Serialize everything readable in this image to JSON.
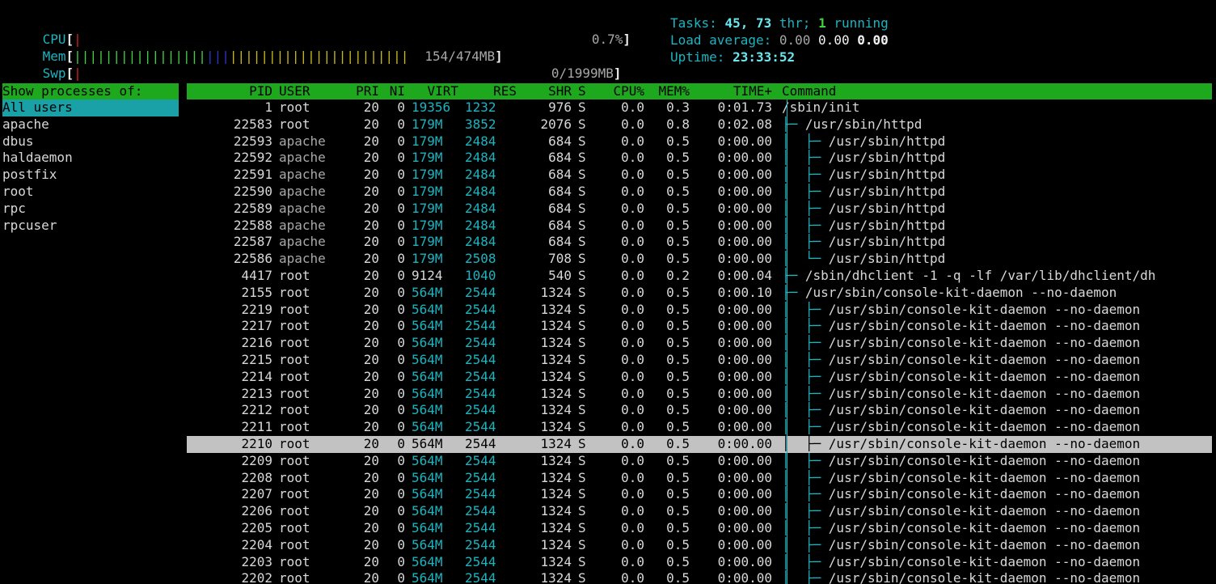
{
  "meters": {
    "cpu": {
      "label": "CPU",
      "percent": "0.7%",
      "usage_fraction": 0.007
    },
    "mem": {
      "label": "Mem",
      "value": "154/474MB",
      "used_mb": 154,
      "total_mb": 474,
      "bar_green": "|||||||||||||||||",
      "bar_blue": "|||",
      "bar_yellow": "|||||||||||||||||||||||"
    },
    "swp": {
      "label": "Swp",
      "value": "0/1999MB",
      "used_mb": 0,
      "total_mb": 1999
    }
  },
  "summary": {
    "tasks_label": "Tasks:",
    "tasks": "45,",
    "threads": "73",
    "threads_label": "thr;",
    "running": "1",
    "running_label": "running",
    "load_label": "Load average:",
    "load1": "0.00",
    "load5": "0.00",
    "load15": "0.00",
    "uptime_label": "Uptime:",
    "uptime": "23:33:52"
  },
  "sidebar": {
    "title": "Show processes of:",
    "items": [
      "All users",
      "apache",
      "dbus",
      "haldaemon",
      "postfix",
      "root",
      "rpc",
      "rpcuser"
    ]
  },
  "columns": {
    "pid": "PID",
    "user": "USER",
    "pri": "PRI",
    "ni": "NI",
    "virt": "VIRT",
    "res": "RES",
    "shr": "SHR",
    "s": "S",
    "cpu": "CPU%",
    "mem": "MEM%",
    "time": "TIME+",
    "command": "Command"
  },
  "processes": [
    {
      "pid": "1",
      "user": "root",
      "pri": "20",
      "ni": "0",
      "virt": "19356",
      "res": "1232",
      "shr": "976",
      "s": "S",
      "cpu": "0.0",
      "mem": "0.3",
      "time": "0:01.73",
      "tree": "",
      "command": "/sbin/init"
    },
    {
      "pid": "22583",
      "user": "root",
      "pri": "20",
      "ni": "0",
      "virt": "179M",
      "res": "3852",
      "shr": "2076",
      "s": "S",
      "cpu": "0.0",
      "mem": "0.8",
      "time": "0:02.08",
      "tree": "├─ ",
      "command": "/usr/sbin/httpd"
    },
    {
      "pid": "22593",
      "user": "apache",
      "pri": "20",
      "ni": "0",
      "virt": "179M",
      "res": "2484",
      "shr": "684",
      "s": "S",
      "cpu": "0.0",
      "mem": "0.5",
      "time": "0:00.00",
      "tree": "│  ├─ ",
      "command": "/usr/sbin/httpd"
    },
    {
      "pid": "22592",
      "user": "apache",
      "pri": "20",
      "ni": "0",
      "virt": "179M",
      "res": "2484",
      "shr": "684",
      "s": "S",
      "cpu": "0.0",
      "mem": "0.5",
      "time": "0:00.00",
      "tree": "│  ├─ ",
      "command": "/usr/sbin/httpd"
    },
    {
      "pid": "22591",
      "user": "apache",
      "pri": "20",
      "ni": "0",
      "virt": "179M",
      "res": "2484",
      "shr": "684",
      "s": "S",
      "cpu": "0.0",
      "mem": "0.5",
      "time": "0:00.00",
      "tree": "│  ├─ ",
      "command": "/usr/sbin/httpd"
    },
    {
      "pid": "22590",
      "user": "apache",
      "pri": "20",
      "ni": "0",
      "virt": "179M",
      "res": "2484",
      "shr": "684",
      "s": "S",
      "cpu": "0.0",
      "mem": "0.5",
      "time": "0:00.00",
      "tree": "│  ├─ ",
      "command": "/usr/sbin/httpd"
    },
    {
      "pid": "22589",
      "user": "apache",
      "pri": "20",
      "ni": "0",
      "virt": "179M",
      "res": "2484",
      "shr": "684",
      "s": "S",
      "cpu": "0.0",
      "mem": "0.5",
      "time": "0:00.00",
      "tree": "│  ├─ ",
      "command": "/usr/sbin/httpd"
    },
    {
      "pid": "22588",
      "user": "apache",
      "pri": "20",
      "ni": "0",
      "virt": "179M",
      "res": "2484",
      "shr": "684",
      "s": "S",
      "cpu": "0.0",
      "mem": "0.5",
      "time": "0:00.00",
      "tree": "│  ├─ ",
      "command": "/usr/sbin/httpd"
    },
    {
      "pid": "22587",
      "user": "apache",
      "pri": "20",
      "ni": "0",
      "virt": "179M",
      "res": "2484",
      "shr": "684",
      "s": "S",
      "cpu": "0.0",
      "mem": "0.5",
      "time": "0:00.00",
      "tree": "│  ├─ ",
      "command": "/usr/sbin/httpd"
    },
    {
      "pid": "22586",
      "user": "apache",
      "pri": "20",
      "ni": "0",
      "virt": "179M",
      "res": "2508",
      "shr": "708",
      "s": "S",
      "cpu": "0.0",
      "mem": "0.5",
      "time": "0:00.00",
      "tree": "│  └─ ",
      "command": "/usr/sbin/httpd"
    },
    {
      "pid": "4417",
      "user": "root",
      "pri": "20",
      "ni": "0",
      "virt": "9124",
      "res": "1040",
      "shr": "540",
      "s": "S",
      "cpu": "0.0",
      "mem": "0.2",
      "time": "0:00.04",
      "tree": "├─ ",
      "command": "/sbin/dhclient -1 -q -lf /var/lib/dhclient/dh"
    },
    {
      "pid": "2155",
      "user": "root",
      "pri": "20",
      "ni": "0",
      "virt": "564M",
      "res": "2544",
      "shr": "1324",
      "s": "S",
      "cpu": "0.0",
      "mem": "0.5",
      "time": "0:00.10",
      "tree": "├─ ",
      "command": "/usr/sbin/console-kit-daemon --no-daemon"
    },
    {
      "pid": "2219",
      "user": "root",
      "pri": "20",
      "ni": "0",
      "virt": "564M",
      "res": "2544",
      "shr": "1324",
      "s": "S",
      "cpu": "0.0",
      "mem": "0.5",
      "time": "0:00.00",
      "tree": "│  ├─ ",
      "command": "/usr/sbin/console-kit-daemon --no-daemon"
    },
    {
      "pid": "2217",
      "user": "root",
      "pri": "20",
      "ni": "0",
      "virt": "564M",
      "res": "2544",
      "shr": "1324",
      "s": "S",
      "cpu": "0.0",
      "mem": "0.5",
      "time": "0:00.00",
      "tree": "│  ├─ ",
      "command": "/usr/sbin/console-kit-daemon --no-daemon"
    },
    {
      "pid": "2216",
      "user": "root",
      "pri": "20",
      "ni": "0",
      "virt": "564M",
      "res": "2544",
      "shr": "1324",
      "s": "S",
      "cpu": "0.0",
      "mem": "0.5",
      "time": "0:00.00",
      "tree": "│  ├─ ",
      "command": "/usr/sbin/console-kit-daemon --no-daemon"
    },
    {
      "pid": "2215",
      "user": "root",
      "pri": "20",
      "ni": "0",
      "virt": "564M",
      "res": "2544",
      "shr": "1324",
      "s": "S",
      "cpu": "0.0",
      "mem": "0.5",
      "time": "0:00.00",
      "tree": "│  ├─ ",
      "command": "/usr/sbin/console-kit-daemon --no-daemon"
    },
    {
      "pid": "2214",
      "user": "root",
      "pri": "20",
      "ni": "0",
      "virt": "564M",
      "res": "2544",
      "shr": "1324",
      "s": "S",
      "cpu": "0.0",
      "mem": "0.5",
      "time": "0:00.00",
      "tree": "│  ├─ ",
      "command": "/usr/sbin/console-kit-daemon --no-daemon"
    },
    {
      "pid": "2213",
      "user": "root",
      "pri": "20",
      "ni": "0",
      "virt": "564M",
      "res": "2544",
      "shr": "1324",
      "s": "S",
      "cpu": "0.0",
      "mem": "0.5",
      "time": "0:00.00",
      "tree": "│  ├─ ",
      "command": "/usr/sbin/console-kit-daemon --no-daemon"
    },
    {
      "pid": "2212",
      "user": "root",
      "pri": "20",
      "ni": "0",
      "virt": "564M",
      "res": "2544",
      "shr": "1324",
      "s": "S",
      "cpu": "0.0",
      "mem": "0.5",
      "time": "0:00.00",
      "tree": "│  ├─ ",
      "command": "/usr/sbin/console-kit-daemon --no-daemon"
    },
    {
      "pid": "2211",
      "user": "root",
      "pri": "20",
      "ni": "0",
      "virt": "564M",
      "res": "2544",
      "shr": "1324",
      "s": "S",
      "cpu": "0.0",
      "mem": "0.5",
      "time": "0:00.00",
      "tree": "│  ├─ ",
      "command": "/usr/sbin/console-kit-daemon --no-daemon"
    },
    {
      "pid": "2210",
      "user": "root",
      "pri": "20",
      "ni": "0",
      "virt": "564M",
      "res": "2544",
      "shr": "1324",
      "s": "S",
      "cpu": "0.0",
      "mem": "0.5",
      "time": "0:00.00",
      "tree": "│  ├─ ",
      "command": "/usr/sbin/console-kit-daemon --no-daemon",
      "selected": true
    },
    {
      "pid": "2209",
      "user": "root",
      "pri": "20",
      "ni": "0",
      "virt": "564M",
      "res": "2544",
      "shr": "1324",
      "s": "S",
      "cpu": "0.0",
      "mem": "0.5",
      "time": "0:00.00",
      "tree": "│  ├─ ",
      "command": "/usr/sbin/console-kit-daemon --no-daemon"
    },
    {
      "pid": "2208",
      "user": "root",
      "pri": "20",
      "ni": "0",
      "virt": "564M",
      "res": "2544",
      "shr": "1324",
      "s": "S",
      "cpu": "0.0",
      "mem": "0.5",
      "time": "0:00.00",
      "tree": "│  ├─ ",
      "command": "/usr/sbin/console-kit-daemon --no-daemon"
    },
    {
      "pid": "2207",
      "user": "root",
      "pri": "20",
      "ni": "0",
      "virt": "564M",
      "res": "2544",
      "shr": "1324",
      "s": "S",
      "cpu": "0.0",
      "mem": "0.5",
      "time": "0:00.00",
      "tree": "│  ├─ ",
      "command": "/usr/sbin/console-kit-daemon --no-daemon"
    },
    {
      "pid": "2206",
      "user": "root",
      "pri": "20",
      "ni": "0",
      "virt": "564M",
      "res": "2544",
      "shr": "1324",
      "s": "S",
      "cpu": "0.0",
      "mem": "0.5",
      "time": "0:00.00",
      "tree": "│  ├─ ",
      "command": "/usr/sbin/console-kit-daemon --no-daemon"
    },
    {
      "pid": "2205",
      "user": "root",
      "pri": "20",
      "ni": "0",
      "virt": "564M",
      "res": "2544",
      "shr": "1324",
      "s": "S",
      "cpu": "0.0",
      "mem": "0.5",
      "time": "0:00.00",
      "tree": "│  ├─ ",
      "command": "/usr/sbin/console-kit-daemon --no-daemon"
    },
    {
      "pid": "2204",
      "user": "root",
      "pri": "20",
      "ni": "0",
      "virt": "564M",
      "res": "2544",
      "shr": "1324",
      "s": "S",
      "cpu": "0.0",
      "mem": "0.5",
      "time": "0:00.00",
      "tree": "│  ├─ ",
      "command": "/usr/sbin/console-kit-daemon --no-daemon"
    },
    {
      "pid": "2203",
      "user": "root",
      "pri": "20",
      "ni": "0",
      "virt": "564M",
      "res": "2544",
      "shr": "1324",
      "s": "S",
      "cpu": "0.0",
      "mem": "0.5",
      "time": "0:00.00",
      "tree": "│  ├─ ",
      "command": "/usr/sbin/console-kit-daemon --no-daemon"
    },
    {
      "pid": "2202",
      "user": "root",
      "pri": "20",
      "ni": "0",
      "virt": "564M",
      "res": "2544",
      "shr": "1324",
      "s": "S",
      "cpu": "0.0",
      "mem": "0.5",
      "time": "0:00.00",
      "tree": "│  ├─ ",
      "command": "/usr/sbin/console-kit-daemon --no-daemon"
    }
  ],
  "colors": {
    "accent_green": "#1ea81e",
    "accent_cyan": "#1aa1a8",
    "selected_row": "#c2c2c2",
    "text_cyan": "#19b5c0"
  }
}
